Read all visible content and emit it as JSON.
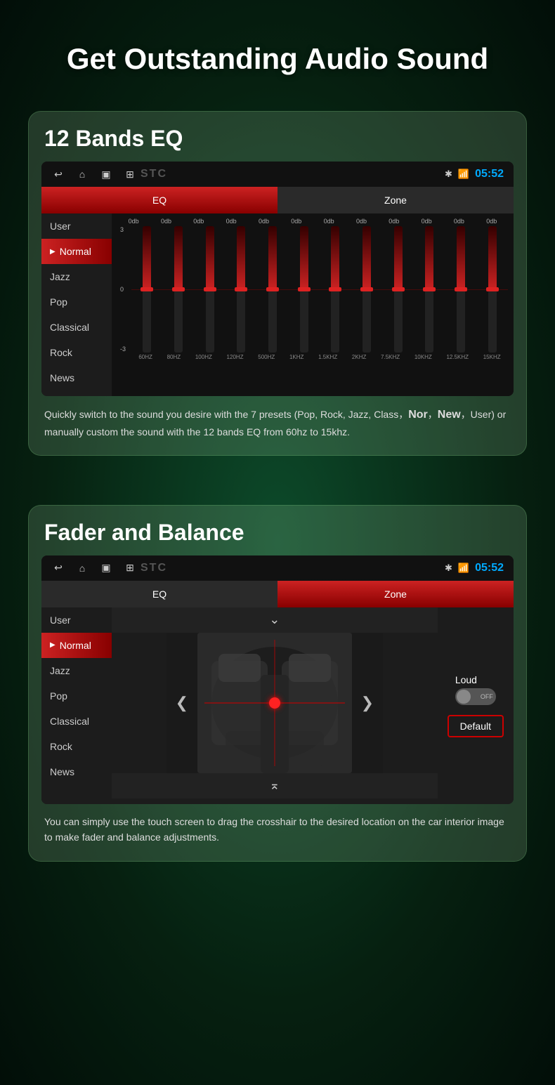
{
  "page": {
    "title": "Get Outstanding Audio Sound"
  },
  "eq_card": {
    "title": "12 Bands EQ",
    "status_time": "05:52",
    "tab_eq": "EQ",
    "tab_zone": "Zone",
    "sidebar": {
      "items": [
        "User",
        "Normal",
        "Jazz",
        "Pop",
        "Classical",
        "Rock",
        "News"
      ],
      "active": 1
    },
    "eq_labels": [
      "0db",
      "0db",
      "0db",
      "0db",
      "0db",
      "0db",
      "0db",
      "0db",
      "0db",
      "0db",
      "0db",
      "0db"
    ],
    "scale": {
      "top": "3",
      "mid": "0",
      "bot": "-3"
    },
    "freq_labels": [
      "60HZ",
      "80HZ",
      "100HZ",
      "120HZ",
      "500HZ",
      "1KHZ",
      "1.5KHZ",
      "2KHZ",
      "7.5KHZ",
      "10KHZ",
      "12.5KHZ",
      "15KHZ"
    ],
    "description": "Quickly switch to the sound you desire with the 7 presets (Pop, Rock, Jazz, Class，Nor，New，User) or manually custom the sound with the 12 bands EQ from 60hz to 15khz."
  },
  "fader_card": {
    "title": "Fader and Balance",
    "status_time": "05:52",
    "tab_eq": "EQ",
    "tab_zone": "Zone",
    "sidebar": {
      "items": [
        "User",
        "Normal",
        "Jazz",
        "Pop",
        "Classical",
        "Rock",
        "News"
      ],
      "active": 1
    },
    "loud_label": "Loud",
    "toggle_label": "OFF",
    "default_btn": "Default",
    "description": "You can simply use the touch screen to drag the crosshair to the desired location on the car interior image to make fader and balance adjustments."
  }
}
